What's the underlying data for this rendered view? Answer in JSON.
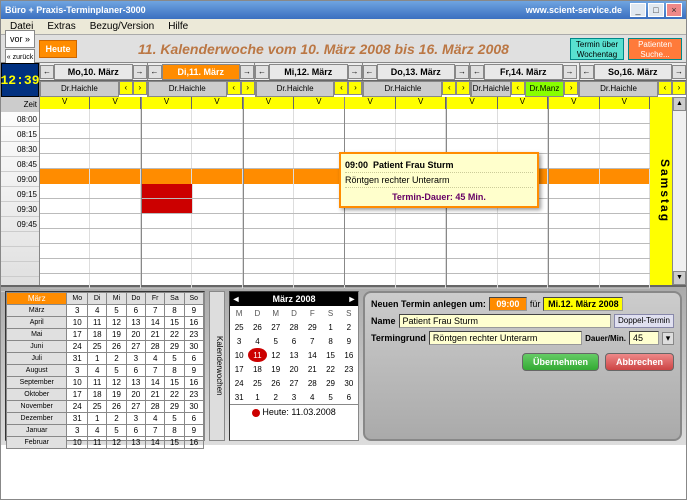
{
  "title": "Büro + Praxis-Terminplaner-3000",
  "url": "www.scient-service.de",
  "menu": [
    "Datei",
    "Extras",
    "Bezug/Version",
    "Hilfe"
  ],
  "nav": {
    "back": "vor »",
    "back2": "« zurück",
    "today": "Heute"
  },
  "kw_title": "11.  Kalenderwoche  vom  10. März 2008  bis   16. März 2008",
  "right_buttons": {
    "wt": "Termin über Wochentag",
    "ps": "Patienten Suche..."
  },
  "clock": "12:39",
  "time_label": "Zeit",
  "days": [
    {
      "label": "Mo,10. März",
      "today": false
    },
    {
      "label": "Di,11. März",
      "today": true
    },
    {
      "label": "Mi,12. März",
      "today": false
    },
    {
      "label": "Do,13. März",
      "today": false
    },
    {
      "label": "Fr,14. März",
      "today": false
    },
    {
      "label": "So,16. März",
      "today": false
    }
  ],
  "doctors": [
    "Dr.Haichle",
    "Dr.Haichle",
    "Dr.Haichle",
    "Dr.Haichle",
    "Dr.Haichle",
    "Dr.Manz",
    "Dr.Haichle"
  ],
  "time_slots": [
    "08:00",
    "08:15",
    "08:30",
    "08:45",
    "09:00",
    "09:15",
    "09:30",
    "09:45",
    "",
    "",
    "",
    ""
  ],
  "appointment_label": "Patient Frau Sturm",
  "tooltip": {
    "time": "09:00",
    "patient": "Patient Frau Sturm",
    "reason": "Röntgen rechter Unterarm",
    "duration": "Termin-Dauer:  45 Min."
  },
  "samstag": "Samstag",
  "months_list": [
    "März",
    "April",
    "Mai",
    "Juni",
    "Juli",
    "August",
    "September",
    "Oktober",
    "November",
    "Dezember",
    "Januar",
    "Februar"
  ],
  "month_header_days": [
    "Mo",
    "Di",
    "Mi",
    "Do",
    "Fr",
    "Sa",
    "So"
  ],
  "month_rows": [
    [
      "3",
      "4",
      "5",
      "6",
      "7",
      "8",
      "9"
    ],
    [
      "10",
      "11",
      "12",
      "13",
      "14",
      "15",
      "16"
    ],
    [
      "17",
      "18",
      "19",
      "20",
      "21",
      "22",
      "23"
    ],
    [
      "24",
      "25",
      "26",
      "27",
      "28",
      "29",
      "30"
    ],
    [
      "31",
      "1",
      "2",
      "3",
      "4",
      "5",
      "6"
    ]
  ],
  "kw_label": "Kalenderwochen",
  "minical": {
    "title": "März 2008",
    "wd": [
      "M",
      "D",
      "M",
      "D",
      "F",
      "S",
      "S"
    ],
    "rows": [
      [
        "25",
        "26",
        "27",
        "28",
        "29",
        "1",
        "2"
      ],
      [
        "3",
        "4",
        "5",
        "6",
        "7",
        "8",
        "9"
      ],
      [
        "10",
        "11",
        "12",
        "13",
        "14",
        "15",
        "16"
      ],
      [
        "17",
        "18",
        "19",
        "20",
        "21",
        "22",
        "23"
      ],
      [
        "24",
        "25",
        "26",
        "27",
        "28",
        "29",
        "30"
      ],
      [
        "31",
        "1",
        "2",
        "3",
        "4",
        "5",
        "6"
      ]
    ],
    "today_cell": "11",
    "footer": "Heute: 11.03.2008"
  },
  "form": {
    "title": "Neuen Termin anlegen um:",
    "time": "09:00",
    "for": "für",
    "date": "Mi.12. März 2008",
    "name_lbl": "Name",
    "name_val": "Patient Frau Sturm",
    "doppel": "Doppel-Termin",
    "grund_lbl": "Termingrund",
    "grund_val": "Röntgen rechter Unterarm",
    "dauer_lbl": "Dauer/Min.",
    "dauer_val": "45",
    "ok": "Übernehmen",
    "cancel": "Abbrechen"
  }
}
